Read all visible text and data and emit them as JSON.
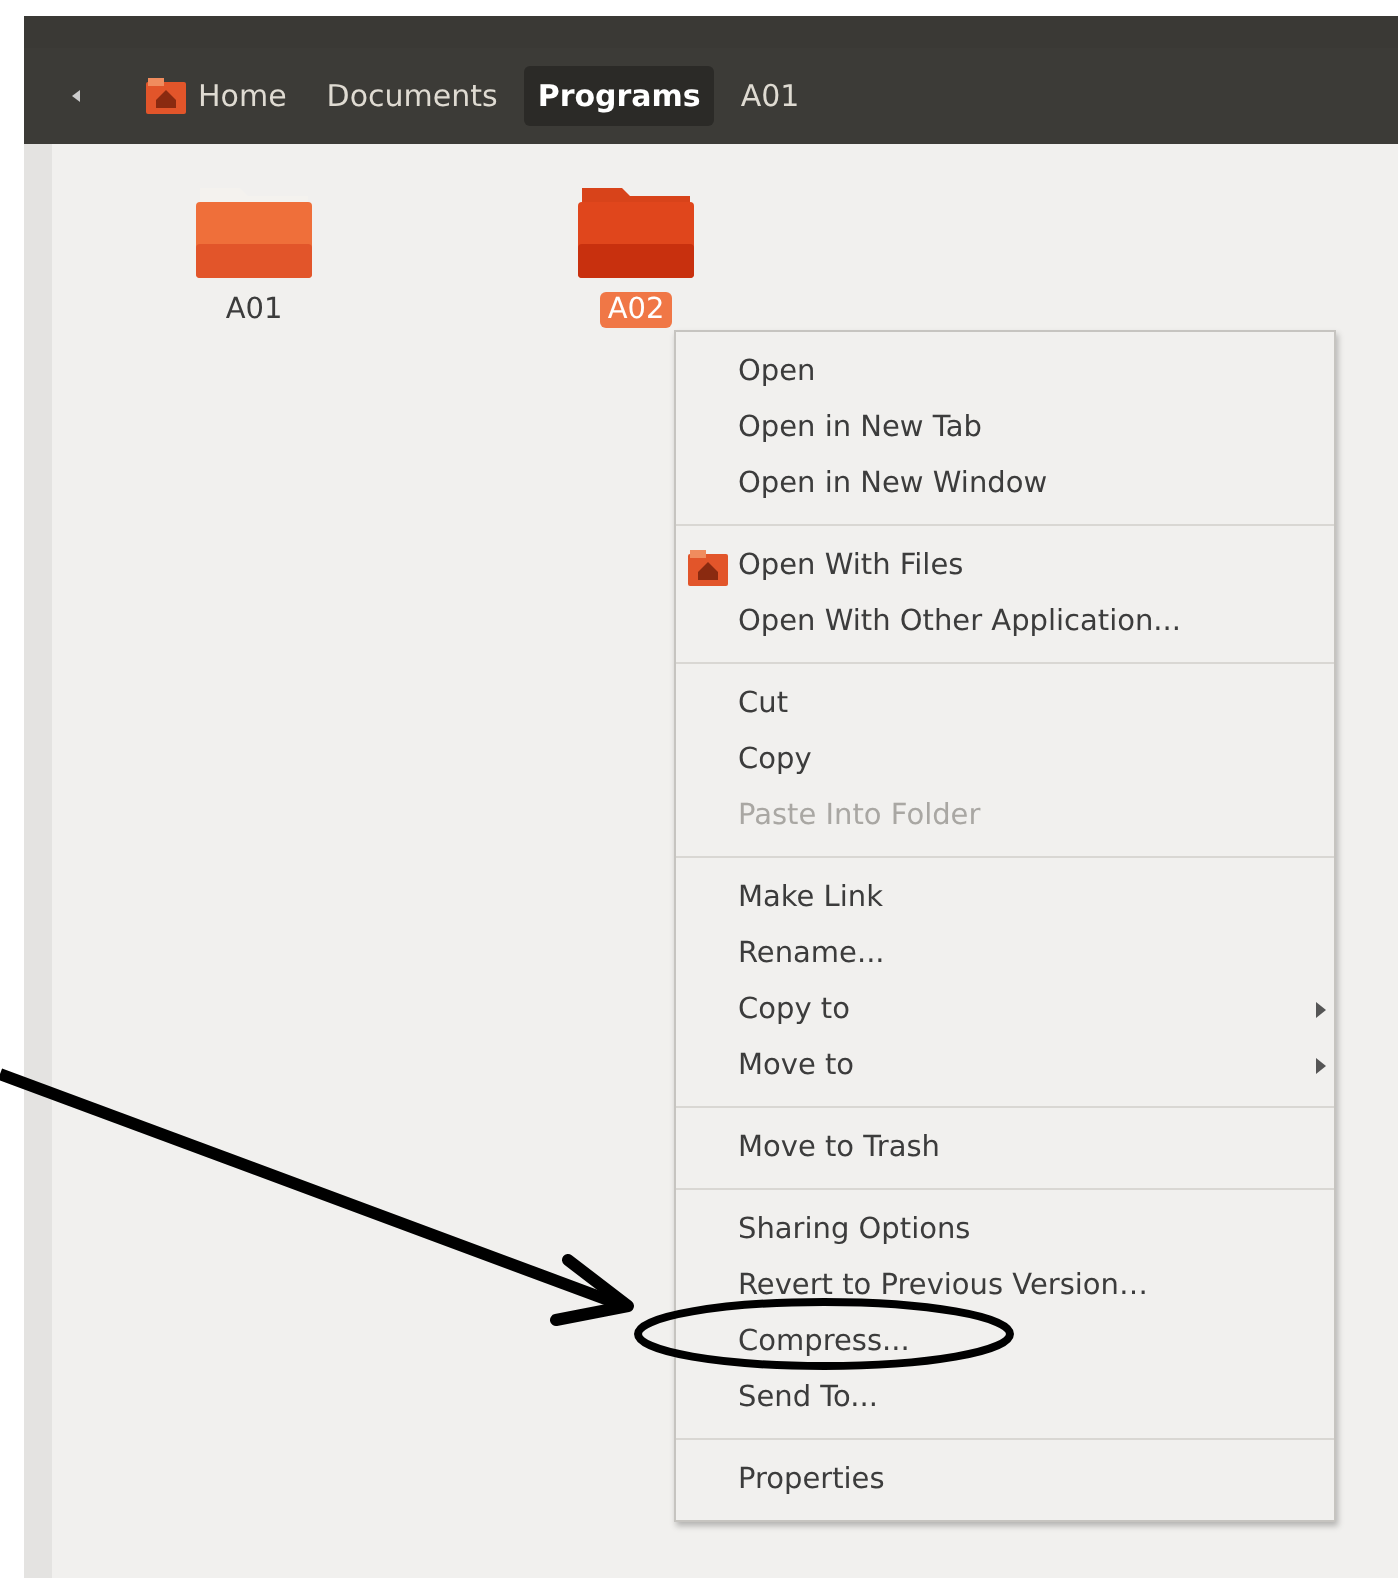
{
  "pathbar": {
    "items": [
      {
        "label": "Home",
        "kind": "home",
        "selected": false
      },
      {
        "label": "Documents",
        "kind": "plain",
        "selected": false
      },
      {
        "label": "Programs",
        "kind": "plain",
        "selected": true
      },
      {
        "label": "A01",
        "kind": "plain",
        "selected": false
      }
    ]
  },
  "files": [
    {
      "name": "A01",
      "selected": false
    },
    {
      "name": "A02",
      "selected": true
    }
  ],
  "context_menu": {
    "sections": [
      [
        {
          "label": "Open",
          "kind": "plain",
          "disabled": false
        },
        {
          "label": "Open in New Tab",
          "kind": "plain",
          "disabled": false
        },
        {
          "label": "Open in New Window",
          "kind": "plain",
          "disabled": false
        }
      ],
      [
        {
          "label": "Open With Files",
          "kind": "icon",
          "disabled": false
        },
        {
          "label": "Open With Other Application...",
          "kind": "plain",
          "disabled": false
        }
      ],
      [
        {
          "label": "Cut",
          "kind": "plain",
          "disabled": false
        },
        {
          "label": "Copy",
          "kind": "plain",
          "disabled": false
        },
        {
          "label": "Paste Into Folder",
          "kind": "plain",
          "disabled": true
        }
      ],
      [
        {
          "label": "Make Link",
          "kind": "plain",
          "disabled": false
        },
        {
          "label": "Rename...",
          "kind": "plain",
          "disabled": false
        },
        {
          "label": "Copy to",
          "kind": "submenu",
          "disabled": false
        },
        {
          "label": "Move to",
          "kind": "submenu",
          "disabled": false
        }
      ],
      [
        {
          "label": "Move to Trash",
          "kind": "plain",
          "disabled": false
        }
      ],
      [
        {
          "label": "Sharing Options",
          "kind": "plain",
          "disabled": false
        },
        {
          "label": "Revert to Previous Version…",
          "kind": "plain",
          "disabled": false
        },
        {
          "label": "Compress...",
          "kind": "plain",
          "disabled": false
        },
        {
          "label": "Send To...",
          "kind": "plain",
          "disabled": false
        }
      ],
      [
        {
          "label": "Properties",
          "kind": "plain",
          "disabled": false
        }
      ]
    ]
  }
}
